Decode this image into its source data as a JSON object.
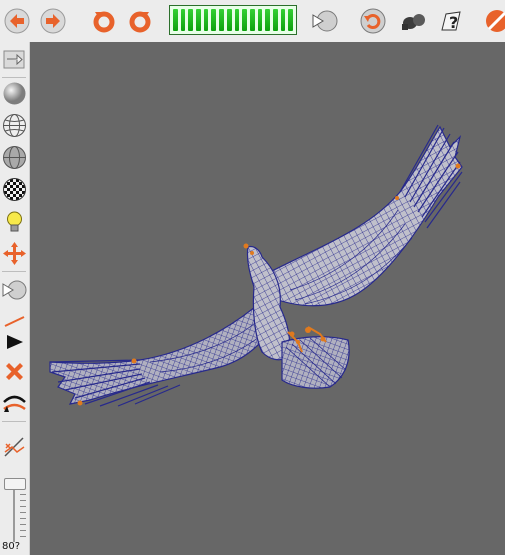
{
  "toolbar": {
    "buttons": [
      {
        "name": "back-arrow-icon",
        "color": "#e8622b"
      },
      {
        "name": "forward-arrow-icon",
        "color": "#e8622b"
      },
      {
        "name": "rotate-left-icon",
        "color": "#e8622b"
      },
      {
        "name": "rotate-right-icon",
        "color": "#e8622b"
      },
      {
        "name": "playback-icon"
      },
      {
        "name": "undo-icon"
      },
      {
        "name": "camera-icon"
      },
      {
        "name": "help-icon"
      },
      {
        "name": "cancel-icon"
      }
    ],
    "progress": {
      "segments_total": 16,
      "segments_filled": 16,
      "fraction": 1.0,
      "color": "#1fb71f"
    }
  },
  "sidebar": {
    "buttons": [
      {
        "name": "export-icon"
      },
      {
        "name": "sphere-solid-icon"
      },
      {
        "name": "sphere-wireframe-icon"
      },
      {
        "name": "sphere-shaded-wireframe-icon"
      },
      {
        "name": "checker-sphere-icon"
      },
      {
        "name": "light-bulb-icon"
      },
      {
        "name": "move-cross-icon"
      },
      {
        "name": "morph-icon"
      },
      {
        "name": "line-tool-icon"
      },
      {
        "name": "triangle-tool-icon"
      },
      {
        "name": "delete-x-icon"
      },
      {
        "name": "bend-tool-icon"
      },
      {
        "name": "snap-tool-icon"
      }
    ],
    "slider": {
      "level": 0.0
    },
    "readout": "80?"
  },
  "viewport": {
    "background": "#676767",
    "mesh_color": "#27298c",
    "surface_color": "#b8b8c2",
    "marker_color": "#e07a1e"
  }
}
